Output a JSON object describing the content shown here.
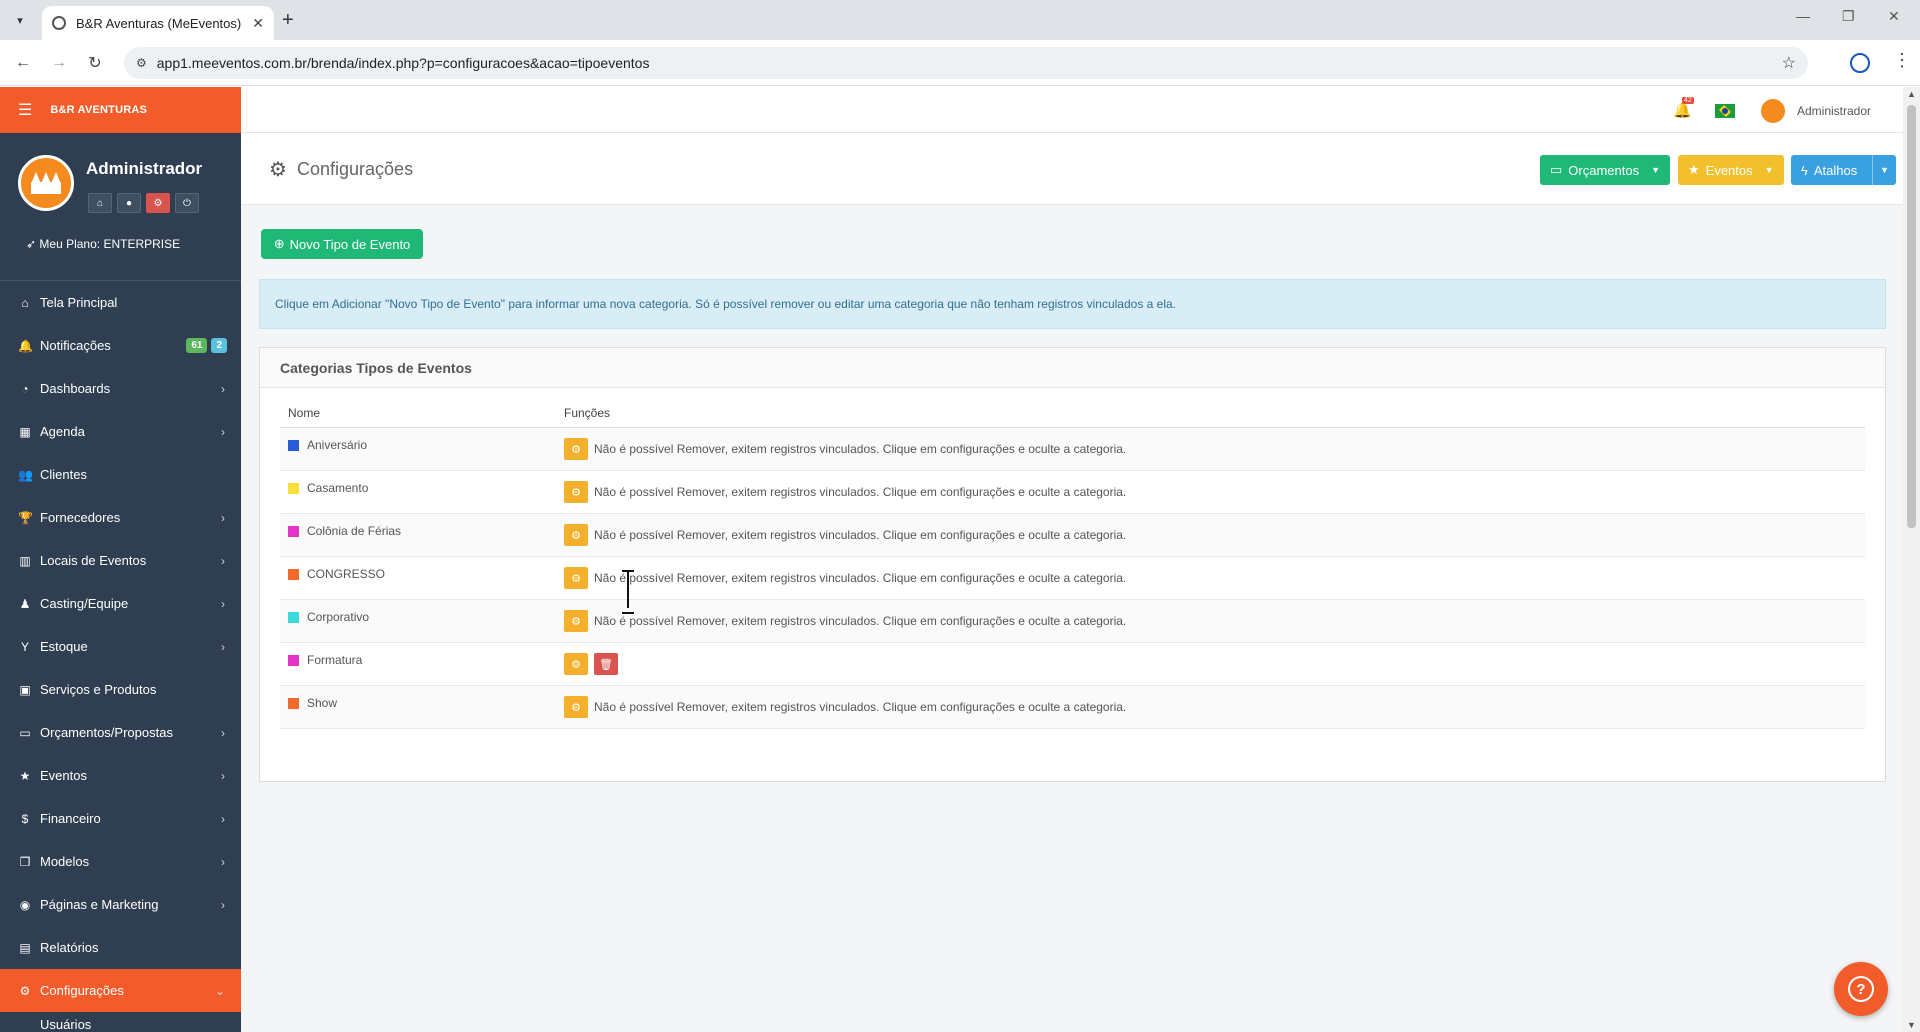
{
  "browser": {
    "tab_title": "B&R Aventuras (MeEventos)",
    "url": "app1.meeventos.com.br/brenda/index.php?p=configuracoes&acao=tipoeventos"
  },
  "sidebar": {
    "brand": "B&R AVENTURAS",
    "username": "Administrador",
    "plan": "Meu Plano: ENTERPRISE",
    "items": [
      {
        "label": "Tela Principal",
        "icon": "home-icon",
        "glyph": "⌂",
        "chevron": false
      },
      {
        "label": "Notificações",
        "icon": "bell-icon",
        "glyph": "🔔",
        "chevron": false
      },
      {
        "label": "Dashboards",
        "icon": "dashboard-icon",
        "glyph": "◔",
        "chevron": true
      },
      {
        "label": "Agenda",
        "icon": "calendar-icon",
        "glyph": "▦",
        "chevron": true
      },
      {
        "label": "Clientes",
        "icon": "users-icon",
        "glyph": "👥",
        "chevron": false
      },
      {
        "label": "Fornecedores",
        "icon": "trophy-icon",
        "glyph": "🏆",
        "chevron": true
      },
      {
        "label": "Locais de Eventos",
        "icon": "building-icon",
        "glyph": "▥",
        "chevron": true
      },
      {
        "label": "Casting/Equipe",
        "icon": "person-icon",
        "glyph": "♟",
        "chevron": true
      },
      {
        "label": "Estoque",
        "icon": "glass-icon",
        "glyph": "Y",
        "chevron": true
      },
      {
        "label": "Serviços e Produtos",
        "icon": "box-icon",
        "glyph": "▣",
        "chevron": false
      },
      {
        "label": "Orçamentos/Propostas",
        "icon": "laptop-icon",
        "glyph": "▭",
        "chevron": true
      },
      {
        "label": "Eventos",
        "icon": "star-icon",
        "glyph": "★",
        "chevron": true
      },
      {
        "label": "Financeiro",
        "icon": "dollar-icon",
        "glyph": "$",
        "chevron": true
      },
      {
        "label": "Modelos",
        "icon": "copy-icon",
        "glyph": "❐",
        "chevron": true
      },
      {
        "label": "Páginas e Marketing",
        "icon": "globe-icon",
        "glyph": "◉",
        "chevron": true
      },
      {
        "label": "Relatórios",
        "icon": "chart-icon",
        "glyph": "▤",
        "chevron": false
      },
      {
        "label": "Configurações",
        "icon": "gear-icon",
        "glyph": "⚙",
        "chevron": true
      }
    ],
    "notif_badges": [
      "61",
      "2"
    ],
    "sub_item": "Usuários"
  },
  "topbar": {
    "bell_count": "42",
    "user": "Administrador"
  },
  "page": {
    "title": "Configurações",
    "btn_orcamentos": "Orçamentos",
    "btn_eventos": "Eventos",
    "btn_atalhos": "Atalhos",
    "btn_novo": "Novo Tipo de Evento",
    "alert": "Clique em Adicionar \"Novo Tipo de Evento\" para informar uma nova categoria. Só é possível remover ou editar uma categoria que não tenham registros vinculados a ela.",
    "card_title": "Categorias Tipos de Eventos",
    "col_nome": "Nome",
    "col_funcoes": "Funções",
    "rows": [
      {
        "name": "Aniversário",
        "color": "#2a5bd7",
        "message": "Não é possível Remover, exitem registros vinculados. Clique em configurações e oculte a categoria.",
        "delete": false
      },
      {
        "name": "Casamento",
        "color": "#f7e03a",
        "message": "Não é possível Remover, exitem registros vinculados. Clique em configurações e oculte a categoria.",
        "delete": false
      },
      {
        "name": "Colônia de Férias",
        "color": "#e535c9",
        "message": "Não é possível Remover, exitem registros vinculados. Clique em configurações e oculte a categoria.",
        "delete": false
      },
      {
        "name": "CONGRESSO",
        "color": "#f26a2c",
        "message": "Não é possível Remover, exitem registros vinculados. Clique em configurações e oculte a categoria.",
        "delete": false
      },
      {
        "name": "Corporativo",
        "color": "#3dd8d8",
        "message": "Não é possível Remover, exitem registros vinculados. Clique em configurações e oculte a categoria.",
        "delete": false
      },
      {
        "name": "Formatura",
        "color": "#e535c9",
        "message": "",
        "delete": true
      },
      {
        "name": "Show",
        "color": "#f26a2c",
        "message": "Não é possível Remover, exitem registros vinculados. Clique em configurações e oculte a categoria.",
        "delete": false
      }
    ]
  },
  "colors": {
    "accent": "#f25c2b",
    "sidebar_bg": "#2f3e51",
    "green": "#1fb877",
    "yellow": "#f3c02d",
    "blue": "#3aa1e0",
    "badge_green": "#5cb85c",
    "badge_blue": "#5bc0de"
  }
}
